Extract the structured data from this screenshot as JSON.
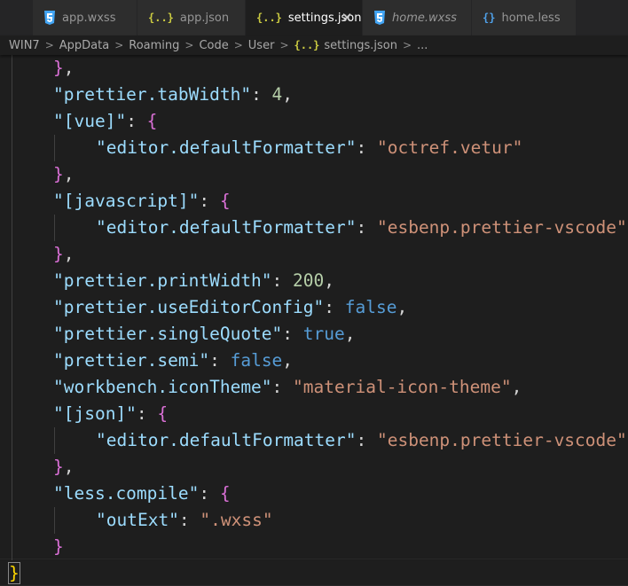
{
  "tabs": [
    {
      "label": "app.wxss",
      "icon": "css-icon",
      "active": false,
      "italic": false
    },
    {
      "label": "app.json",
      "icon": "json-icon",
      "active": false,
      "italic": false
    },
    {
      "label": "settings.json",
      "icon": "json-icon",
      "active": true,
      "italic": false,
      "close": "✕"
    },
    {
      "label": "home.wxss",
      "icon": "css-icon",
      "active": false,
      "italic": true
    },
    {
      "label": "home.less",
      "icon": "braces-icon",
      "active": false,
      "italic": false
    }
  ],
  "breadcrumb": {
    "items": [
      "WIN7",
      "AppData",
      "Roaming",
      "Code",
      "User"
    ],
    "file": "settings.json",
    "file_icon": "{..}",
    "ellipsis": "..."
  },
  "code": {
    "lines": [
      {
        "indent": 1,
        "tokens": [
          [
            "brace",
            "}"
          ],
          [
            "punc",
            ","
          ]
        ]
      },
      {
        "indent": 1,
        "tokens": [
          [
            "key",
            "\"prettier.tabWidth\""
          ],
          [
            "punc",
            ": "
          ],
          [
            "num",
            "4"
          ],
          [
            "punc",
            ","
          ]
        ]
      },
      {
        "indent": 1,
        "tokens": [
          [
            "key",
            "\"[vue]\""
          ],
          [
            "punc",
            ": "
          ],
          [
            "brace",
            "{"
          ]
        ]
      },
      {
        "indent": 2,
        "tokens": [
          [
            "key",
            "\"editor.defaultFormatter\""
          ],
          [
            "punc",
            ": "
          ],
          [
            "str",
            "\"octref.vetur\""
          ]
        ]
      },
      {
        "indent": 1,
        "tokens": [
          [
            "brace",
            "}"
          ],
          [
            "punc",
            ","
          ]
        ]
      },
      {
        "indent": 1,
        "tokens": [
          [
            "key",
            "\"[javascript]\""
          ],
          [
            "punc",
            ": "
          ],
          [
            "brace",
            "{"
          ]
        ]
      },
      {
        "indent": 2,
        "tokens": [
          [
            "key",
            "\"editor.defaultFormatter\""
          ],
          [
            "punc",
            ": "
          ],
          [
            "str",
            "\"esbenp.prettier-vscode\""
          ]
        ]
      },
      {
        "indent": 1,
        "tokens": [
          [
            "brace",
            "}"
          ],
          [
            "punc",
            ","
          ]
        ]
      },
      {
        "indent": 1,
        "tokens": [
          [
            "key",
            "\"prettier.printWidth\""
          ],
          [
            "punc",
            ": "
          ],
          [
            "num",
            "200"
          ],
          [
            "punc",
            ","
          ]
        ]
      },
      {
        "indent": 1,
        "tokens": [
          [
            "key",
            "\"prettier.useEditorConfig\""
          ],
          [
            "punc",
            ": "
          ],
          [
            "bool",
            "false"
          ],
          [
            "punc",
            ","
          ]
        ]
      },
      {
        "indent": 1,
        "tokens": [
          [
            "key",
            "\"prettier.singleQuote\""
          ],
          [
            "punc",
            ": "
          ],
          [
            "bool",
            "true"
          ],
          [
            "punc",
            ","
          ]
        ]
      },
      {
        "indent": 1,
        "tokens": [
          [
            "key",
            "\"prettier.semi\""
          ],
          [
            "punc",
            ": "
          ],
          [
            "bool",
            "false"
          ],
          [
            "punc",
            ","
          ]
        ]
      },
      {
        "indent": 1,
        "tokens": [
          [
            "key",
            "\"workbench.iconTheme\""
          ],
          [
            "punc",
            ": "
          ],
          [
            "str",
            "\"material-icon-theme\""
          ],
          [
            "punc",
            ","
          ]
        ]
      },
      {
        "indent": 1,
        "tokens": [
          [
            "key",
            "\"[json]\""
          ],
          [
            "punc",
            ": "
          ],
          [
            "brace",
            "{"
          ]
        ]
      },
      {
        "indent": 2,
        "tokens": [
          [
            "key",
            "\"editor.defaultFormatter\""
          ],
          [
            "punc",
            ": "
          ],
          [
            "str",
            "\"esbenp.prettier-vscode\""
          ]
        ]
      },
      {
        "indent": 1,
        "tokens": [
          [
            "brace",
            "}"
          ],
          [
            "punc",
            ","
          ]
        ]
      },
      {
        "indent": 1,
        "tokens": [
          [
            "key",
            "\"less.compile\""
          ],
          [
            "punc",
            ": "
          ],
          [
            "brace",
            "{"
          ]
        ]
      },
      {
        "indent": 2,
        "tokens": [
          [
            "key",
            "\"outExt\""
          ],
          [
            "punc",
            ": "
          ],
          [
            "str",
            "\".wxss\""
          ]
        ]
      },
      {
        "indent": 1,
        "tokens": [
          [
            "brace",
            "}"
          ]
        ]
      },
      {
        "indent": 0,
        "tokens": [
          [
            "brace-y",
            "}"
          ]
        ]
      }
    ]
  }
}
